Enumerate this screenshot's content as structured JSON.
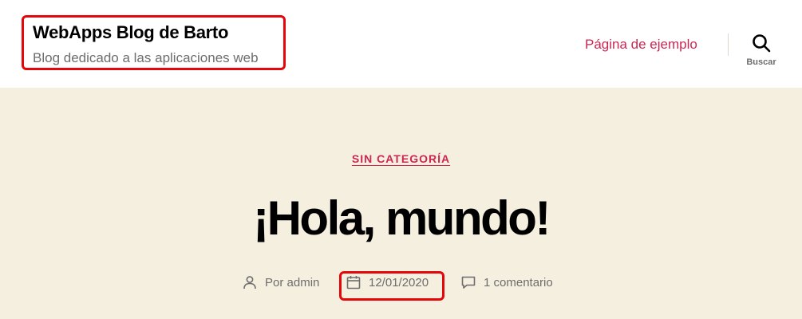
{
  "header": {
    "site_title": "WebApps Blog de Barto",
    "site_description": "Blog dedicado a las aplicaciones web",
    "nav_items": [
      {
        "label": "Página de ejemplo"
      }
    ],
    "search_label": "Buscar"
  },
  "post": {
    "category": "SIN CATEGORÍA",
    "title": "¡Hola, mundo!",
    "author_prefix": "Por ",
    "author": "admin",
    "date": "12/01/2020",
    "comments": "1 comentario"
  },
  "colors": {
    "accent": "#cd2653",
    "highlight_box": "#e5060b",
    "content_background": "#f5efe0",
    "header_background": "#ffffff"
  },
  "icons": {
    "author": "user-icon",
    "date": "calendar-icon",
    "comments": "comment-icon",
    "search": "search-icon"
  }
}
